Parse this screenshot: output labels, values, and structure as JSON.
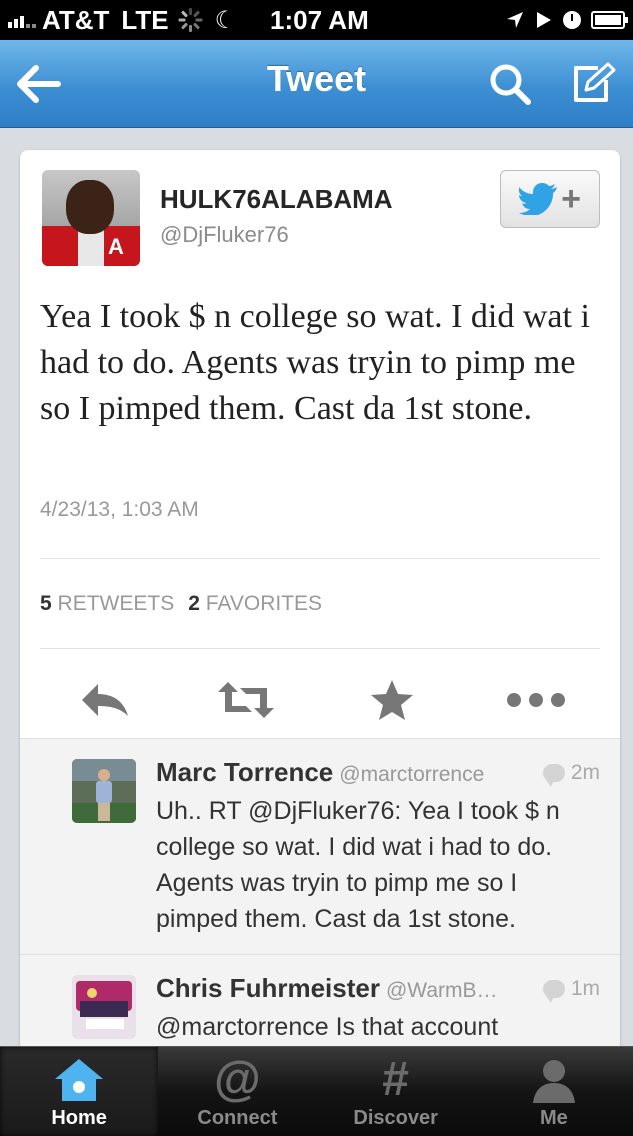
{
  "status_bar": {
    "carrier": "AT&T",
    "network": "LTE",
    "time": "1:07 AM",
    "icons": [
      "signal-icon",
      "activity-spinner-icon",
      "do-not-disturb-moon-icon",
      "location-arrow-icon",
      "play-icon",
      "alarm-clock-icon",
      "battery-charging-icon"
    ]
  },
  "nav": {
    "title": "Tweet",
    "back_icon": "back-arrow-icon",
    "search_icon": "search-icon",
    "compose_icon": "compose-icon"
  },
  "tweet": {
    "author_name": "HULK76ALABAMA",
    "author_handle": "@DjFluker76",
    "text": "Yea I took $ n college so wat. I did wat i had to do. Agents was tryin to pimp me so I pimped them. Cast da 1st stone.",
    "timestamp": "4/23/13, 1:03 AM",
    "retweet_count": "5",
    "retweet_label": "RETWEETS",
    "favorite_count": "2",
    "favorite_label": "FAVORITES",
    "follow_icon": "twitter-bird-follow-icon",
    "actions": [
      "reply-icon",
      "retweet-icon",
      "favorite-star-icon",
      "more-dots-icon"
    ]
  },
  "replies": [
    {
      "name": "Marc Torrence",
      "handle": "@marctorrence",
      "time": "2m",
      "text": "Uh.. RT @DjFluker76: Yea I took $ n college so wat. I did wat i had to do. Agents was tryin to pimp me so I pimped them. Cast da 1st stone."
    },
    {
      "name": "Chris Fuhrmeister",
      "handle": "@WarmB…",
      "time": "1m",
      "text": "@marctorrence Is that account"
    }
  ],
  "tabs": [
    {
      "label": "Home",
      "icon": "home-icon",
      "active": true
    },
    {
      "label": "Connect",
      "icon": "at-sign-icon",
      "active": false
    },
    {
      "label": "Discover",
      "icon": "hashtag-icon",
      "active": false
    },
    {
      "label": "Me",
      "icon": "person-icon",
      "active": false
    }
  ],
  "colors": {
    "nav_blue": "#3d8fd3",
    "twitter_blue": "#2fa3e6",
    "tab_bar": "#141414"
  }
}
